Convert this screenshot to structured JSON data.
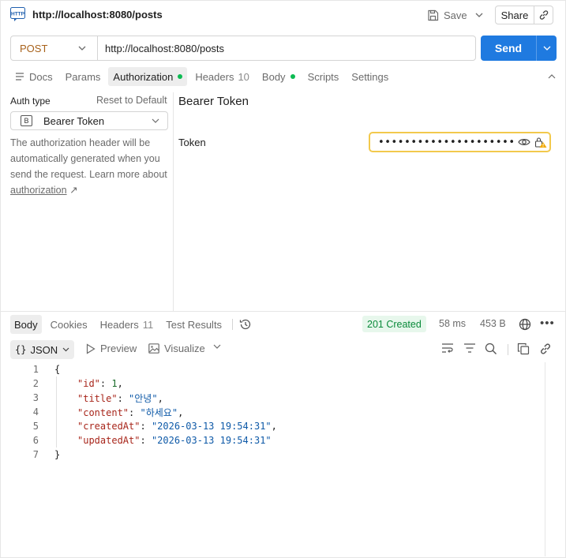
{
  "tab": {
    "title": "http://localhost:8080/posts",
    "icon": "http-icon"
  },
  "toolbar": {
    "save_label": "Save",
    "share_label": "Share"
  },
  "request": {
    "method": "POST",
    "url": "http://localhost:8080/posts",
    "send_label": "Send",
    "tabs": [
      {
        "label": "Docs"
      },
      {
        "label": "Params"
      },
      {
        "label": "Authorization",
        "dot": true
      },
      {
        "label": "Headers",
        "count": "10"
      },
      {
        "label": "Body",
        "dot": true
      },
      {
        "label": "Scripts"
      },
      {
        "label": "Settings"
      }
    ],
    "active_tab": "Authorization"
  },
  "auth": {
    "type_label": "Auth type",
    "reset_label": "Reset to Default",
    "selected_type": "Bearer Token",
    "badge": "B",
    "description_prefix": "The authorization header will be automatically generated when you send the request. Learn more about ",
    "description_link": "authorization",
    "description_link_arrow": "↗",
    "panel_title": "Bearer Token",
    "token_label": "Token",
    "token_masked": "••••••••••••••••••••••••••"
  },
  "response": {
    "tabs": [
      {
        "label": "Body"
      },
      {
        "label": "Cookies"
      },
      {
        "label": "Headers",
        "count": "11"
      },
      {
        "label": "Test Results"
      }
    ],
    "status": "201 Created",
    "time": "58 ms",
    "size": "453 B",
    "format": "JSON",
    "format_braces": "{}",
    "preview_label": "Preview",
    "visualize_label": "Visualize",
    "line_numbers": [
      "1",
      "2",
      "3",
      "4",
      "5",
      "6",
      "7"
    ],
    "body": {
      "open": "{",
      "close": "}",
      "fields": [
        {
          "key": "\"id\"",
          "value": "1",
          "kind": "number"
        },
        {
          "key": "\"title\"",
          "value": "\"안녕\"",
          "kind": "string"
        },
        {
          "key": "\"content\"",
          "value": "\"하세요\"",
          "kind": "string"
        },
        {
          "key": "\"createdAt\"",
          "value": "\"2026-03-13 19:54:31\"",
          "kind": "string"
        },
        {
          "key": "\"updatedAt\"",
          "value": "\"2026-03-13 19:54:31\"",
          "kind": "string"
        }
      ]
    }
  },
  "colors": {
    "accent": "#1f7ae0",
    "method_post": "#a8621b",
    "status_ok_text": "#0a8a3a",
    "status_ok_bg": "#e7f7ec",
    "dot_green": "#0cbb52",
    "warning_border": "#f2c94c"
  }
}
